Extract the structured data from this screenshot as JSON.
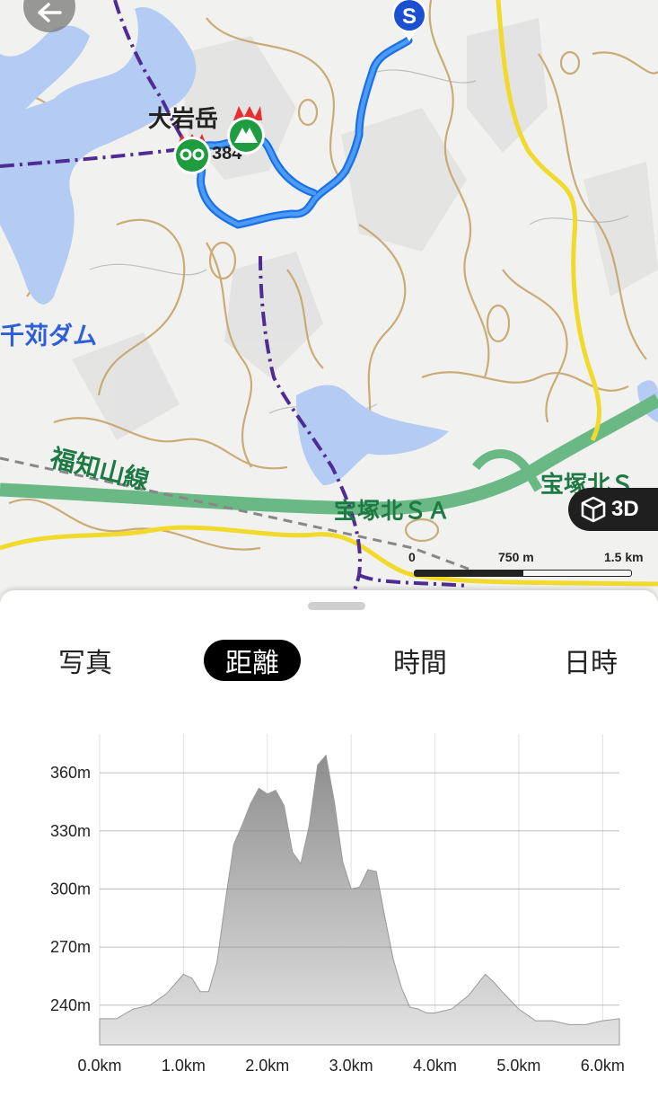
{
  "map": {
    "labels": {
      "peak": "大岩岳",
      "peak_elev": "384",
      "dam": "千苅ダム",
      "railway": "福知山線",
      "sa1": "宝塚北ＳＡ",
      "sa2": "宝塚北Ｓ"
    },
    "start_marker": "S",
    "btn3d_label": "3D",
    "scale": {
      "zero": "0",
      "mid": "750 m",
      "end": "1.5 km"
    },
    "icons": [
      "back-arrow-icon",
      "start-pin-icon",
      "summit-icon",
      "viewpoint-icon",
      "cube-3d-icon"
    ]
  },
  "tabs": [
    {
      "label": "写真",
      "active": false
    },
    {
      "label": "距離",
      "active": true
    },
    {
      "label": "時間",
      "active": false
    },
    {
      "label": "日時",
      "active": false
    }
  ],
  "chart_data": {
    "type": "area",
    "xlabel": "",
    "ylabel": "",
    "xlim": [
      0,
      6.2
    ],
    "ylim": [
      219.5,
      380
    ],
    "x_ticks": [
      "0.0km",
      "1.0km",
      "2.0km",
      "3.0km",
      "4.0km",
      "5.0km",
      "6.0km"
    ],
    "x_tick_values": [
      0,
      1,
      2,
      3,
      4,
      5,
      6
    ],
    "y_ticks": [
      "240m",
      "270m",
      "300m",
      "330m",
      "360m"
    ],
    "y_tick_values": [
      240,
      270,
      300,
      330,
      360
    ],
    "grid": true,
    "series": [
      {
        "x": [
          0,
          0.2,
          0.4,
          0.6,
          0.8,
          0.9,
          1.0,
          1.1,
          1.2,
          1.3,
          1.4,
          1.5,
          1.6,
          1.7,
          1.8,
          1.9,
          2.0,
          2.1,
          2.2,
          2.3,
          2.4,
          2.5,
          2.6,
          2.7,
          2.8,
          2.85,
          2.9,
          3.0,
          3.1,
          3.2,
          3.3,
          3.4,
          3.5,
          3.6,
          3.7,
          3.8,
          3.9,
          4.0,
          4.2,
          4.4,
          4.6,
          4.7,
          4.8,
          5.0,
          5.2,
          5.4,
          5.6,
          5.8,
          6.0,
          6.2
        ],
        "y": [
          233,
          233,
          238,
          240,
          246,
          251,
          256,
          254,
          247,
          247,
          262,
          294,
          323,
          333,
          344,
          352,
          349,
          351,
          343,
          319,
          313,
          333,
          364,
          369,
          345,
          329,
          314,
          300,
          301,
          310,
          309,
          286,
          264,
          249,
          239,
          238,
          236,
          236,
          238,
          245,
          256,
          252,
          247,
          238,
          232,
          232,
          230,
          230,
          232,
          233
        ]
      }
    ]
  }
}
